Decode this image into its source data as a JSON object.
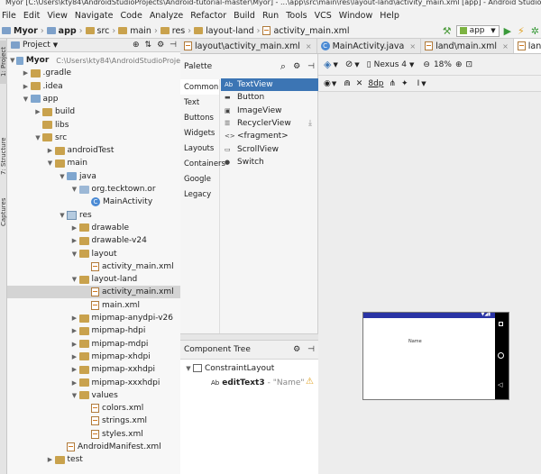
{
  "title_text": "Myor [C:\\Users\\kty84\\AndroidStudioProjects\\Android-tutorial-master\\Myor] - ...\\app\\src\\main\\res\\layout-land\\activity_main.xml [app] - Android Studio",
  "menu": [
    "File",
    "Edit",
    "View",
    "Navigate",
    "Code",
    "Analyze",
    "Refactor",
    "Build",
    "Run",
    "Tools",
    "VCS",
    "Window",
    "Help"
  ],
  "breadcrumb": [
    "Myor",
    "app",
    "src",
    "main",
    "res",
    "layout-land",
    "activity_main.xml"
  ],
  "run_config": "app",
  "project_panel": {
    "title": "Project"
  },
  "side_tabs": [
    "1: Project",
    "7: Structure",
    "Captures"
  ],
  "tree": [
    {
      "label": "Myor",
      "extra": "C:\\Users\\kty84\\AndroidStudioProje",
      "indent": 0,
      "arrow": "down",
      "icon": "fb"
    },
    {
      "label": ".gradle",
      "indent": 1,
      "arrow": "right",
      "icon": "f"
    },
    {
      "label": ".idea",
      "indent": 1,
      "arrow": "right",
      "icon": "f"
    },
    {
      "label": "app",
      "indent": 1,
      "arrow": "down",
      "icon": "fb"
    },
    {
      "label": "build",
      "indent": 2,
      "arrow": "right",
      "icon": "f"
    },
    {
      "label": "libs",
      "indent": 2,
      "arrow": "",
      "icon": "f"
    },
    {
      "label": "src",
      "indent": 2,
      "arrow": "down",
      "icon": "f"
    },
    {
      "label": "androidTest",
      "indent": 3,
      "arrow": "right",
      "icon": "f"
    },
    {
      "label": "main",
      "indent": 3,
      "arrow": "down",
      "icon": "f"
    },
    {
      "label": "java",
      "indent": 4,
      "arrow": "down",
      "icon": "fb"
    },
    {
      "label": "org.tecktown.or",
      "indent": 5,
      "arrow": "down",
      "icon": "fg"
    },
    {
      "label": "MainActivity",
      "indent": 6,
      "arrow": "",
      "icon": "c"
    },
    {
      "label": "res",
      "indent": 4,
      "arrow": "down",
      "icon": "m"
    },
    {
      "label": "drawable",
      "indent": 5,
      "arrow": "right",
      "icon": "f"
    },
    {
      "label": "drawable-v24",
      "indent": 5,
      "arrow": "right",
      "icon": "f"
    },
    {
      "label": "layout",
      "indent": 5,
      "arrow": "down",
      "icon": "f"
    },
    {
      "label": "activity_main.xml",
      "indent": 6,
      "arrow": "",
      "icon": "x"
    },
    {
      "label": "layout-land",
      "indent": 5,
      "arrow": "down",
      "icon": "f"
    },
    {
      "label": "activity_main.xml",
      "indent": 6,
      "arrow": "",
      "icon": "x",
      "selected": true
    },
    {
      "label": "main.xml",
      "indent": 6,
      "arrow": "",
      "icon": "x"
    },
    {
      "label": "mipmap-anydpi-v26",
      "indent": 5,
      "arrow": "right",
      "icon": "f"
    },
    {
      "label": "mipmap-hdpi",
      "indent": 5,
      "arrow": "right",
      "icon": "f"
    },
    {
      "label": "mipmap-mdpi",
      "indent": 5,
      "arrow": "right",
      "icon": "f"
    },
    {
      "label": "mipmap-xhdpi",
      "indent": 5,
      "arrow": "right",
      "icon": "f"
    },
    {
      "label": "mipmap-xxhdpi",
      "indent": 5,
      "arrow": "right",
      "icon": "f"
    },
    {
      "label": "mipmap-xxxhdpi",
      "indent": 5,
      "arrow": "right",
      "icon": "f"
    },
    {
      "label": "values",
      "indent": 5,
      "arrow": "down",
      "icon": "f"
    },
    {
      "label": "colors.xml",
      "indent": 6,
      "arrow": "",
      "icon": "x"
    },
    {
      "label": "strings.xml",
      "indent": 6,
      "arrow": "",
      "icon": "x"
    },
    {
      "label": "styles.xml",
      "indent": 6,
      "arrow": "",
      "icon": "x"
    },
    {
      "label": "AndroidManifest.xml",
      "indent": 4,
      "arrow": "",
      "icon": "x"
    },
    {
      "label": "test",
      "indent": 3,
      "arrow": "right",
      "icon": "f"
    }
  ],
  "tabs": [
    {
      "label": "layout\\activity_main.xml",
      "icon": "x"
    },
    {
      "label": "MainActivity.java",
      "icon": "c"
    },
    {
      "label": "land\\main.xml",
      "icon": "x"
    },
    {
      "label": "land\\activity_main.xml",
      "icon": "x",
      "active": true
    }
  ],
  "palette": {
    "title": "Palette",
    "categories": [
      "Common",
      "Text",
      "Buttons",
      "Widgets",
      "Layouts",
      "Containers",
      "Google",
      "Legacy"
    ],
    "items": [
      {
        "glyph": "Ab",
        "label": "TextView",
        "highlight": true
      },
      {
        "glyph": "▬",
        "label": "Button"
      },
      {
        "glyph": "▣",
        "label": "ImageView"
      },
      {
        "glyph": "☰",
        "label": "RecyclerView"
      },
      {
        "glyph": "<>",
        "label": "<fragment>"
      },
      {
        "glyph": "▭",
        "label": "ScrollView"
      },
      {
        "glyph": "●",
        "label": "Switch"
      }
    ]
  },
  "design_toolbar": {
    "device": "Nexus 4",
    "zoom": "18%",
    "margin": "8dp"
  },
  "component_tree": {
    "title": "Component Tree",
    "root": "ConstraintLayout",
    "child_id": "editText3",
    "child_text": "- \"Name\""
  },
  "preview_text": "Name"
}
